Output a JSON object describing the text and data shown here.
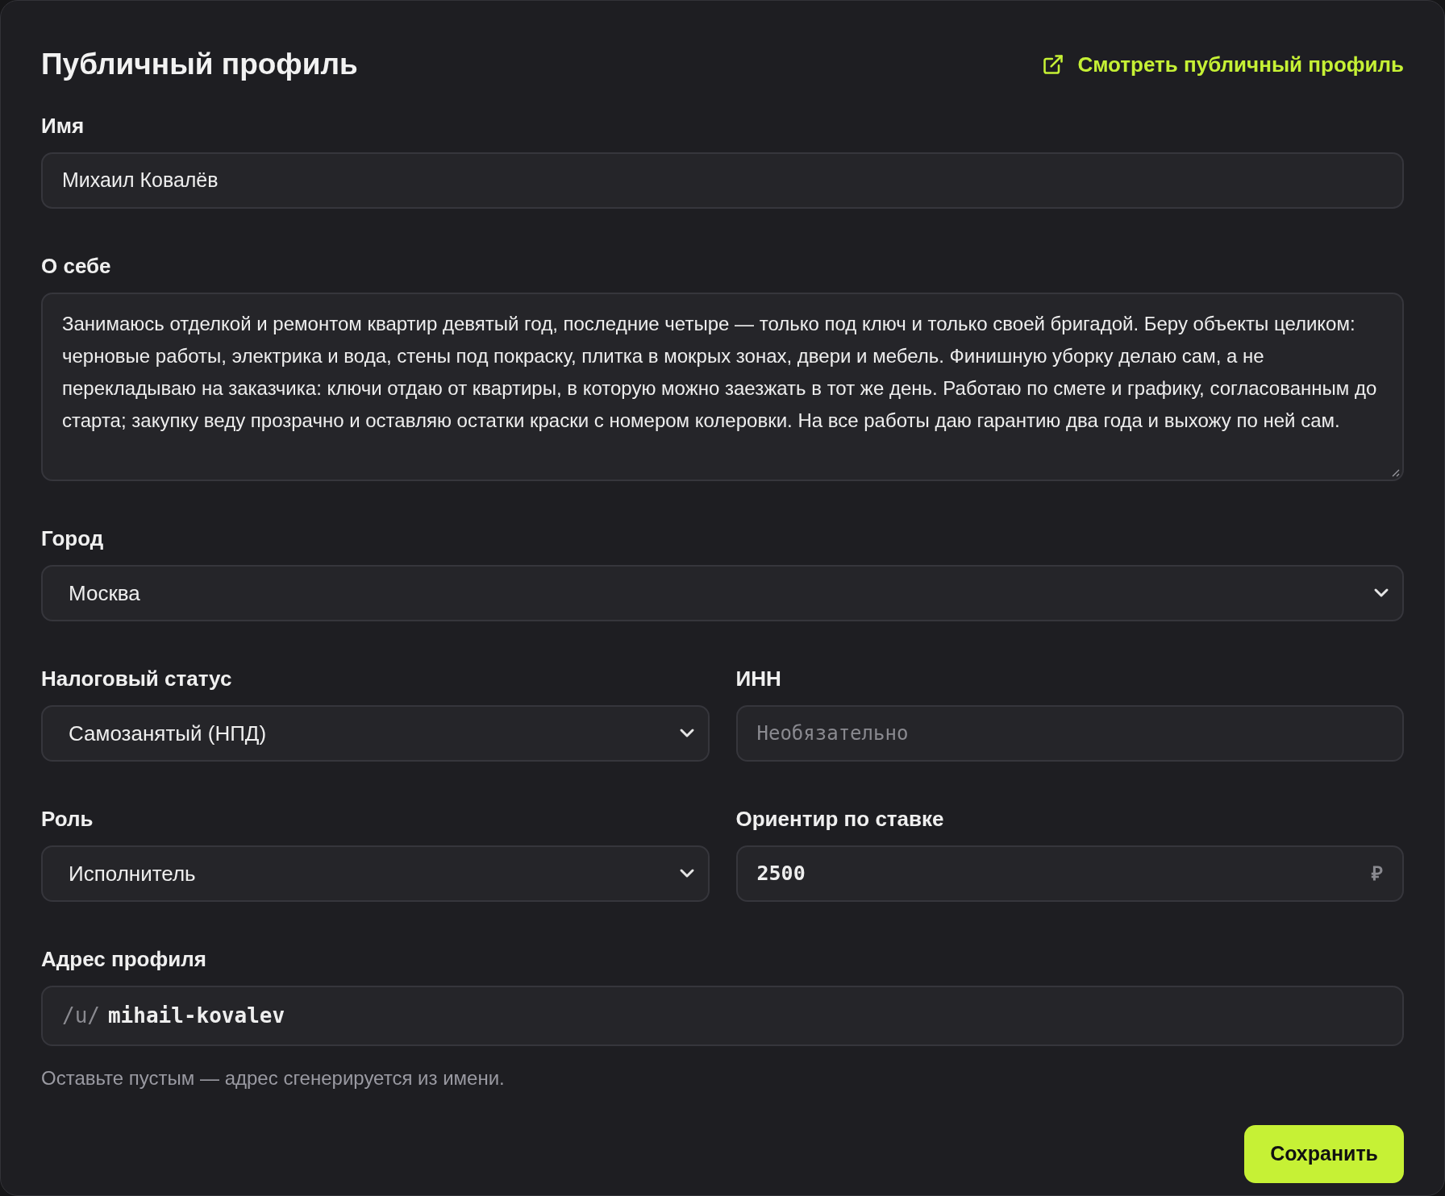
{
  "title": "Публичный профиль",
  "view_link": {
    "label": "Смотреть публичный профиль"
  },
  "fields": [
    {
      "kind": "text",
      "label": "Имя",
      "value": "Михаил Ковалёв"
    },
    {
      "kind": "textarea",
      "label": "О себе",
      "value": "Занимаюсь отделкой и ремонтом квартир девятый год, последние четыре — только под ключ и только своей бригадой. Беру объекты целиком: черновые работы, электрика и вода, стены под покраску, плитка в мокрых зонах, двери и мебель. Финишную уборку делаю сам, а не перекладываю на заказчика: ключи отдаю от квартиры, в которую можно заезжать в тот же день. Работаю по смете и графику, согласованным до старта; закупку веду прозрачно и оставляю остатки краски с номером колеровки. На все работы даю гарантию два года и выхожу по ней сам."
    },
    {
      "kind": "select",
      "label": "Город",
      "value": "Москва"
    }
  ],
  "rows": [
    [
      {
        "kind": "select",
        "label": "Налоговый статус",
        "value": "Самозанятый (НПД)"
      },
      {
        "kind": "text",
        "label": "ИНН",
        "placeholder": "Необязательно"
      }
    ],
    [
      {
        "kind": "select",
        "label": "Роль",
        "value": "Исполнитель"
      },
      {
        "kind": "suffix",
        "label": "Ориентир по ставке",
        "value": "2500",
        "suffix": "₽"
      }
    ]
  ],
  "slug": {
    "label": "Адрес профиля",
    "prefix": "/u/",
    "value": "mihail-kovalev",
    "hint": "Оставьте пустым — адрес сгенерируется из имени."
  },
  "save_button": "Сохранить"
}
